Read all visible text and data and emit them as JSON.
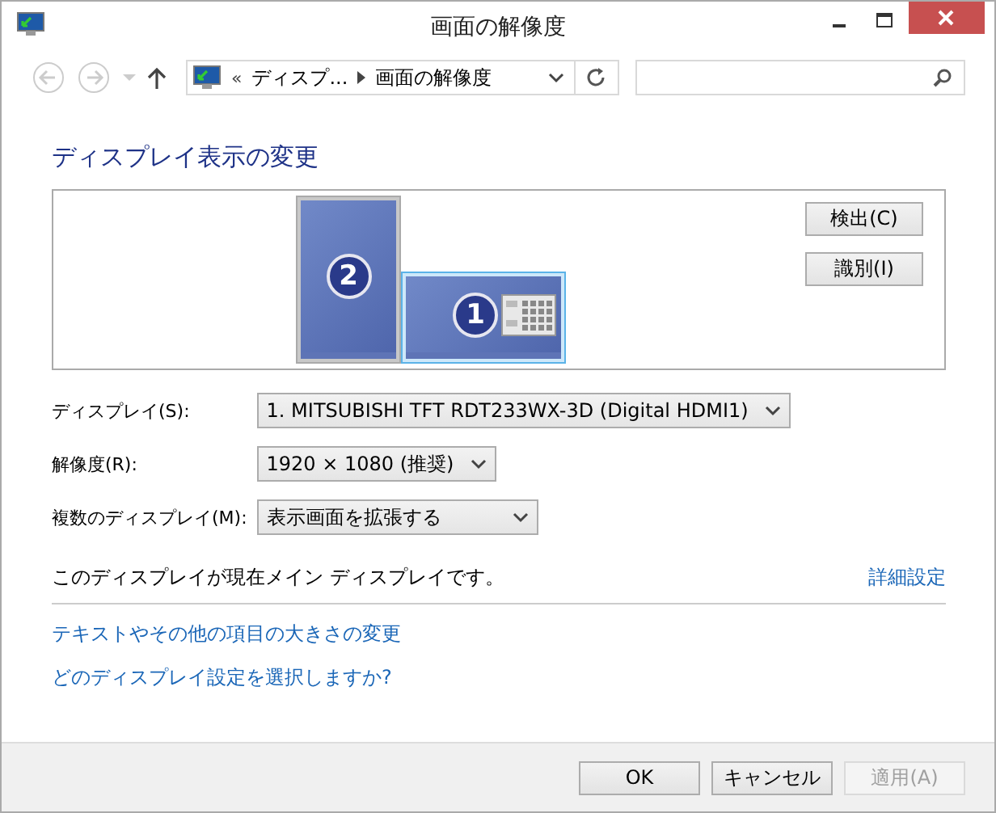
{
  "window": {
    "title": "画面の解像度"
  },
  "address_bar": {
    "overflow": "«",
    "segments": [
      "ディスプ...",
      "画面の解像度"
    ]
  },
  "heading": "ディスプレイ表示の変更",
  "displays": [
    {
      "number": "2",
      "kind": "portrait",
      "selected": false
    },
    {
      "number": "1",
      "kind": "landscape",
      "selected": true
    }
  ],
  "arrangement_buttons": [
    "検出(C)",
    "識別(I)"
  ],
  "settings": [
    {
      "label": "ディスプレイ(S):",
      "value": "1. MITSUBISHI TFT RDT233WX-3D (Digital HDMI1)"
    },
    {
      "label": "解像度(R):",
      "value": "1920 × 1080 (推奨)"
    },
    {
      "label": "複数のディスプレイ(M):",
      "value": "表示画面を拡張する"
    }
  ],
  "status_text": "このディスプレイが現在メイン ディスプレイです。",
  "advanced_link": "詳細設定",
  "links": [
    "テキストやその他の項目の大きさの変更",
    "どのディスプレイ設定を選択しますか?"
  ],
  "buttons": [
    {
      "label": "OK",
      "disabled": false
    },
    {
      "label": "キャンセル",
      "disabled": false
    },
    {
      "label": "適用(A)",
      "disabled": true
    }
  ]
}
